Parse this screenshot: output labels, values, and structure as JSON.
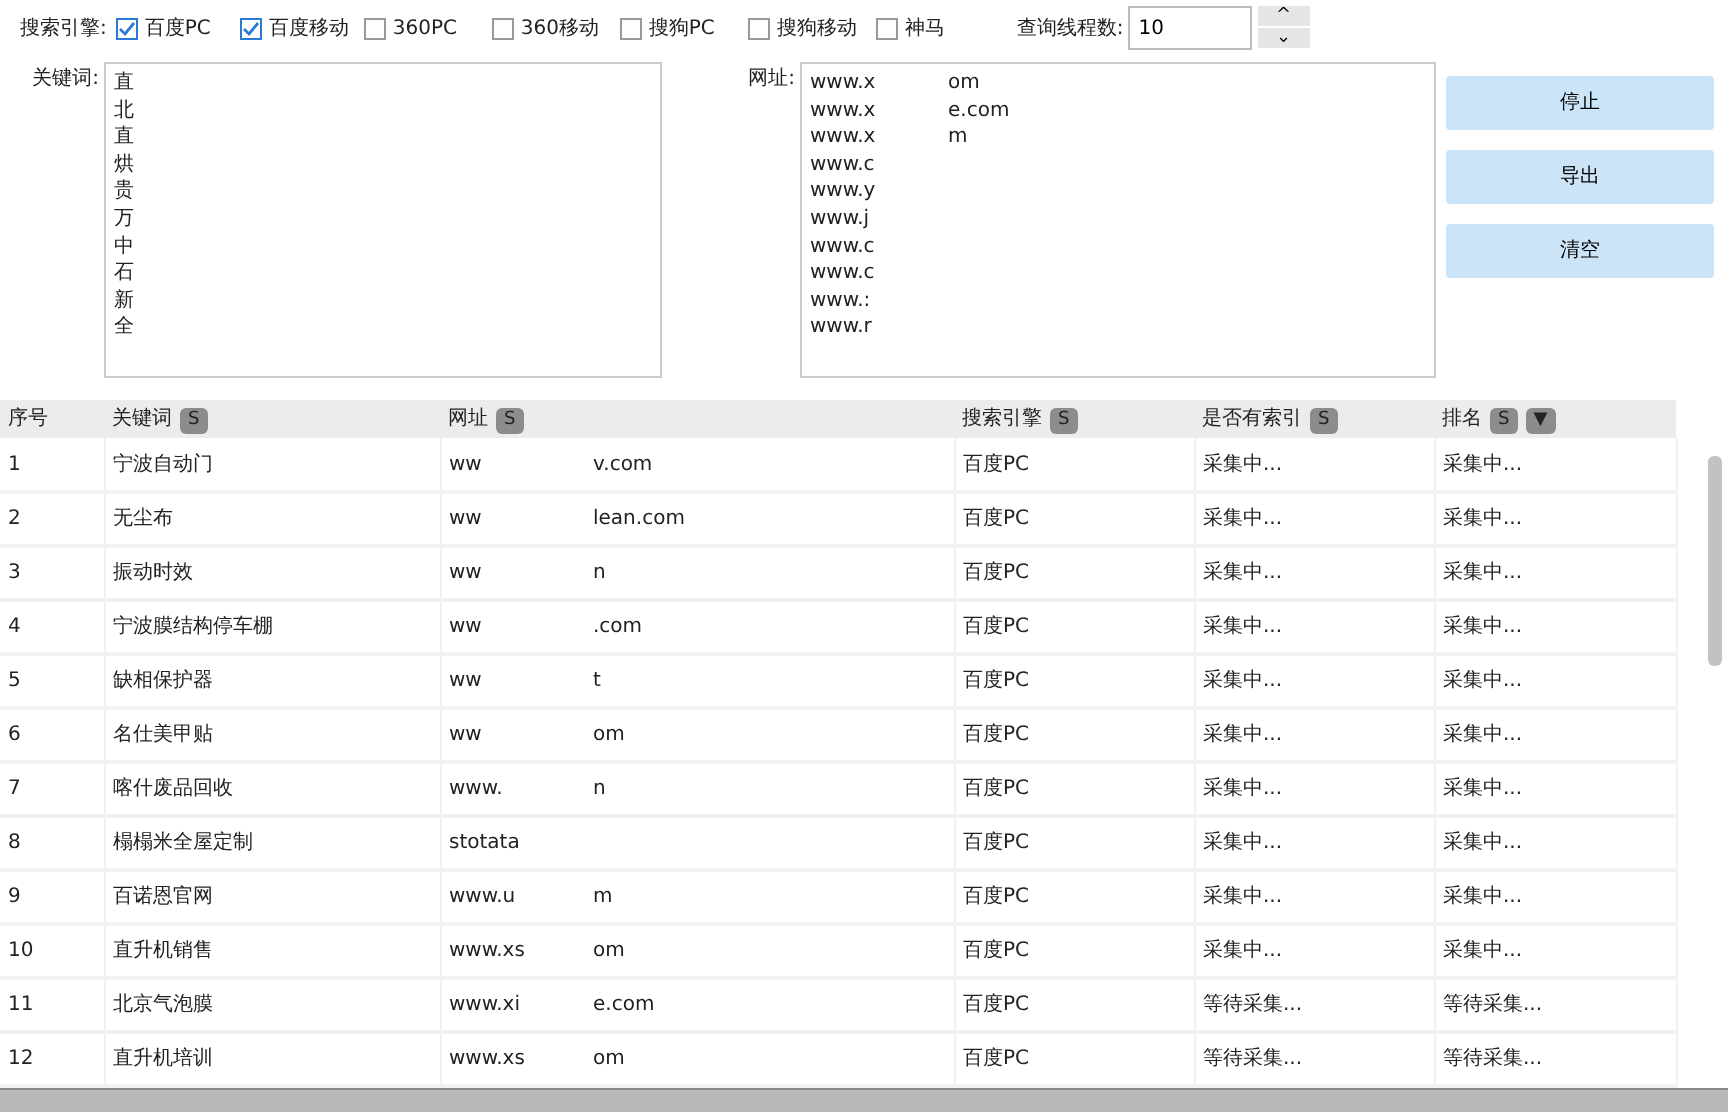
{
  "engine_label": "搜索引擎:",
  "engines": [
    {
      "label": "百度PC",
      "checked": true
    },
    {
      "label": "百度移动",
      "checked": true
    },
    {
      "label": "360PC",
      "checked": false
    },
    {
      "label": "360移动",
      "checked": false
    },
    {
      "label": "搜狗PC",
      "checked": false
    },
    {
      "label": "搜狗移动",
      "checked": false
    },
    {
      "label": "神马",
      "checked": false
    }
  ],
  "threads": {
    "label": "查询线程数:",
    "value": "10",
    "up": "^",
    "down": "⌄"
  },
  "keywords": {
    "label": "关键词:",
    "lines": [
      "直",
      "北",
      "直",
      "烘",
      "贵",
      "万",
      "中",
      "石",
      "新",
      "全"
    ]
  },
  "urls": {
    "label": "网址:",
    "lines": [
      {
        "start": "www.x",
        "end": "om"
      },
      {
        "start": "www.x",
        "end": "e.com"
      },
      {
        "start": "www.x",
        "end": "m"
      },
      {
        "start": "www.c"
      },
      {
        "start": "www.y"
      },
      {
        "start": "www.j"
      },
      {
        "start": "www.c"
      },
      {
        "start": "www.c"
      },
      {
        "start": "www.:"
      },
      {
        "start": "www.r"
      }
    ]
  },
  "buttons": [
    "停止",
    "导出",
    "清空"
  ],
  "table": {
    "columns": [
      {
        "label": "序号"
      },
      {
        "label": "关键词",
        "sort": "S"
      },
      {
        "label": "网址",
        "sort": "S"
      },
      {
        "label": "搜索引擎",
        "sort": "S"
      },
      {
        "label": "是否有索引",
        "sort": "S"
      },
      {
        "label": "排名",
        "sort": "S",
        "filter": "▼"
      }
    ],
    "rows": [
      [
        "1",
        "宁波自动门",
        {
          "start": "ww",
          "end": "v.com"
        },
        "百度PC",
        "采集中...",
        "采集中..."
      ],
      [
        "2",
        "无尘布",
        {
          "start": "ww",
          "end": "lean.com"
        },
        "百度PC",
        "采集中...",
        "采集中..."
      ],
      [
        "3",
        "振动时效",
        {
          "start": "ww",
          "end": "n"
        },
        "百度PC",
        "采集中...",
        "采集中..."
      ],
      [
        "4",
        "宁波膜结构停车棚",
        {
          "start": "ww",
          "end": ".com"
        },
        "百度PC",
        "采集中...",
        "采集中..."
      ],
      [
        "5",
        "缺相保护器",
        {
          "start": "ww",
          "end": "t"
        },
        "百度PC",
        "采集中...",
        "采集中..."
      ],
      [
        "6",
        "名仕美甲贴",
        {
          "start": "ww",
          "end": "om"
        },
        "百度PC",
        "采集中...",
        "采集中..."
      ],
      [
        "7",
        "喀什废品回收",
        {
          "start": "www.",
          "end": "n"
        },
        "百度PC",
        "采集中...",
        "采集中..."
      ],
      [
        "8",
        "榻榻米全屋定制",
        {
          "start": "stotata"
        },
        "百度PC",
        "采集中...",
        "采集中..."
      ],
      [
        "9",
        "百诺恩官网",
        {
          "start": "www.u",
          "end": "m"
        },
        "百度PC",
        "采集中...",
        "采集中..."
      ],
      [
        "10",
        "直升机销售",
        {
          "start": "www.xs",
          "end": "om"
        },
        "百度PC",
        "采集中...",
        "采集中..."
      ],
      [
        "11",
        "北京气泡膜",
        {
          "start": "www.xi",
          "end": "e.com"
        },
        "百度PC",
        "等待采集...",
        "等待采集..."
      ],
      [
        "12",
        "直升机培训",
        {
          "start": "www.xs",
          "end": "om"
        },
        "百度PC",
        "等待采集...",
        "等待采集..."
      ]
    ]
  }
}
